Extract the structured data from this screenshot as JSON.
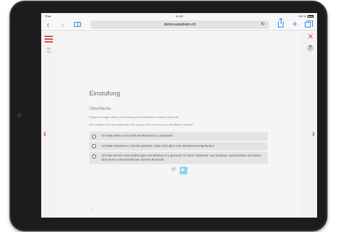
{
  "status_bar": {
    "carrier": "iPad",
    "time": "10:33",
    "battery": "100 %"
  },
  "browser": {
    "url": "demo.easylearn.ch",
    "reload_icon": "reload-icon"
  },
  "page": {
    "progress": "36/\n123",
    "title": "Einstufung",
    "subtitle": "Oberfläche",
    "intro": "Folgende Fragen dient zur Einstufung Ihres Wissens zu diesem Abschnitt.",
    "question": "Wie schätzen Sie sich selbst ein? Wie gut sind Sie mit der neuen Oberfläche vertraut?",
    "options": [
      {
        "label": "Ich habe bisher noch nicht mit Windows 8.1 gearbeitet."
      },
      {
        "label": "Ich habe Windows 8.1 bereits gestartet, habe mich aber nicht überall zurechtgefunden."
      },
      {
        "label": "Ich habe bereits erste Erfahrungen mit Windows 8.1 gemacht. Ich kann 'Startseite' und 'Desktop' unterscheiden und weiss über deren unterschiedlichen Zwecke Bescheid."
      }
    ],
    "page_number": "1"
  },
  "colors": {
    "accent": "#e04a4a",
    "submit": "#8fd3ec",
    "browser_blue": "#1a8bf2"
  }
}
